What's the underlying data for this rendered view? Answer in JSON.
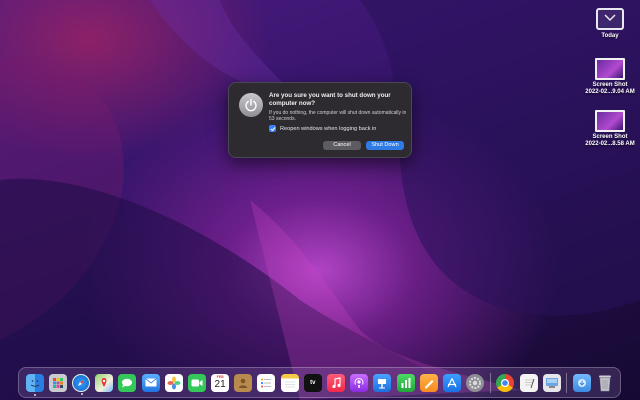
{
  "desktop": {
    "items": [
      {
        "label": "Today"
      },
      {
        "label_line1": "Screen Shot",
        "label_line2": "2022-02...9.04 AM"
      },
      {
        "label_line1": "Screen Shot",
        "label_line2": "2022-02...8.58 AM"
      }
    ]
  },
  "dialog": {
    "title": "Are you sure you want to shut down your computer now?",
    "message": "If you do nothing, the computer will shut down automatically in 53 seconds.",
    "checkbox_label": "Reopen windows when logging back in",
    "checkbox_checked": true,
    "cancel_label": "Cancel",
    "shutdown_label": "Shut Down",
    "icon": "power-icon"
  },
  "dock": {
    "calendar_month": "FEB",
    "calendar_day": "21",
    "tv_label": "tv",
    "apps": [
      "Finder",
      "Launchpad",
      "Safari",
      "Maps",
      "Messages",
      "Mail",
      "Photos",
      "FaceTime",
      "Calendar",
      "Contacts",
      "Reminders",
      "Notes",
      "TV",
      "Music",
      "Podcasts",
      "Keynote",
      "Numbers",
      "Pages",
      "App Store",
      "System Preferences",
      "Chrome",
      "TextEdit",
      "Preview",
      "Downloads",
      "Trash"
    ]
  },
  "colors": {
    "accent": "#2f7be6",
    "dialog_bg": "#2d2b30"
  }
}
